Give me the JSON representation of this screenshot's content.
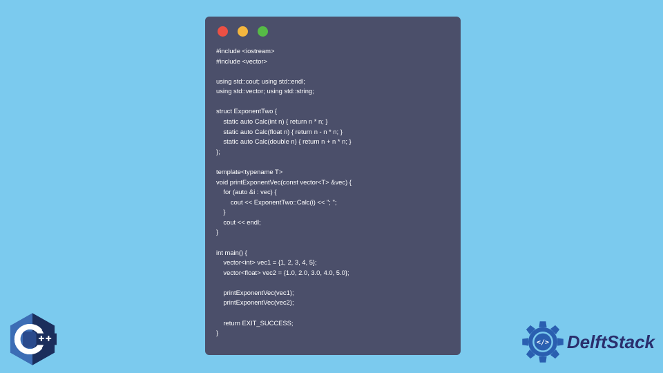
{
  "window": {
    "dots": [
      "red",
      "yellow",
      "green"
    ]
  },
  "code": {
    "content": "#include <iostream>\n#include <vector>\n\nusing std::cout; using std::endl;\nusing std::vector; using std::string;\n\nstruct ExponentTwo {\n    static auto Calc(int n) { return n * n; }\n    static auto Calc(float n) { return n - n * n; }\n    static auto Calc(double n) { return n + n * n; }\n};\n\ntemplate<typename T>\nvoid printExponentVec(const vector<T> &vec) {\n    for (auto &i : vec) {\n        cout << ExponentTwo::Calc(i) << \"; \";\n    }\n    cout << endl;\n}\n\nint main() {\n    vector<int> vec1 = {1, 2, 3, 4, 5};\n    vector<float> vec2 = {1.0, 2.0, 3.0, 4.0, 5.0};\n\n    printExponentVec(vec1);\n    printExponentVec(vec2);\n\n    return EXIT_SUCCESS;\n}"
  },
  "logos": {
    "cpp_label": "C++",
    "delft_label": "DelftStack"
  }
}
